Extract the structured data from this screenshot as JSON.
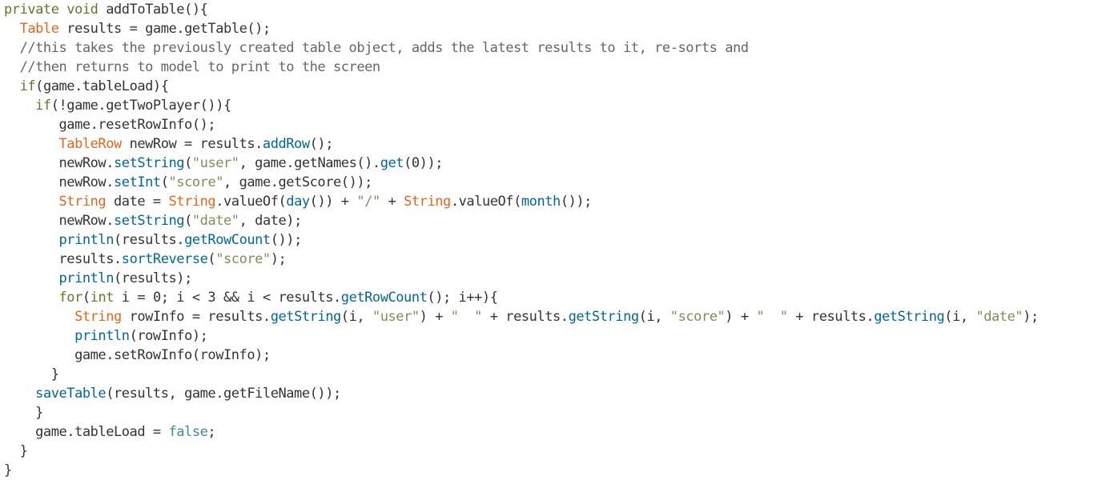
{
  "code": {
    "lines": [
      {
        "tokens": [
          {
            "t": "private void",
            "k": "kw"
          },
          {
            "t": " addToTable(){",
            "k": "plain"
          }
        ]
      },
      {
        "tokens": [
          {
            "t": "  ",
            "k": "plain"
          },
          {
            "t": "Table",
            "k": "type"
          },
          {
            "t": " results = game.getTable();",
            "k": "plain"
          }
        ]
      },
      {
        "tokens": [
          {
            "t": "  //this takes the previously created table object, adds the latest results to it, re-sorts and",
            "k": "comment"
          }
        ]
      },
      {
        "tokens": [
          {
            "t": "  //then returns to model to print to the screen",
            "k": "comment"
          }
        ]
      },
      {
        "tokens": [
          {
            "t": "  ",
            "k": "plain"
          },
          {
            "t": "if",
            "k": "kw"
          },
          {
            "t": "(game.tableLoad){",
            "k": "plain"
          }
        ]
      },
      {
        "tokens": [
          {
            "t": "    ",
            "k": "plain"
          },
          {
            "t": "if",
            "k": "kw"
          },
          {
            "t": "(!game.getTwoPlayer()){",
            "k": "plain"
          }
        ]
      },
      {
        "tokens": [
          {
            "t": "       game.resetRowInfo();",
            "k": "plain"
          }
        ]
      },
      {
        "tokens": [
          {
            "t": "       ",
            "k": "plain"
          },
          {
            "t": "TableRow",
            "k": "type"
          },
          {
            "t": " newRow = results.",
            "k": "plain"
          },
          {
            "t": "addRow",
            "k": "fn"
          },
          {
            "t": "();",
            "k": "plain"
          }
        ]
      },
      {
        "tokens": [
          {
            "t": "       newRow.",
            "k": "plain"
          },
          {
            "t": "setString",
            "k": "fn"
          },
          {
            "t": "(",
            "k": "plain"
          },
          {
            "t": "\"user\"",
            "k": "str"
          },
          {
            "t": ", game.getNames().",
            "k": "plain"
          },
          {
            "t": "get",
            "k": "fn"
          },
          {
            "t": "(0));",
            "k": "plain"
          }
        ]
      },
      {
        "tokens": [
          {
            "t": "       newRow.",
            "k": "plain"
          },
          {
            "t": "setInt",
            "k": "fn"
          },
          {
            "t": "(",
            "k": "plain"
          },
          {
            "t": "\"score\"",
            "k": "str"
          },
          {
            "t": ", game.getScore());",
            "k": "plain"
          }
        ]
      },
      {
        "tokens": [
          {
            "t": "       ",
            "k": "plain"
          },
          {
            "t": "String",
            "k": "type"
          },
          {
            "t": " date = ",
            "k": "plain"
          },
          {
            "t": "String",
            "k": "type"
          },
          {
            "t": ".valueOf(",
            "k": "plain"
          },
          {
            "t": "day",
            "k": "fn"
          },
          {
            "t": "()) + ",
            "k": "plain"
          },
          {
            "t": "\"/\"",
            "k": "str"
          },
          {
            "t": " + ",
            "k": "plain"
          },
          {
            "t": "String",
            "k": "type"
          },
          {
            "t": ".valueOf(",
            "k": "plain"
          },
          {
            "t": "month",
            "k": "fn"
          },
          {
            "t": "());",
            "k": "plain"
          }
        ]
      },
      {
        "tokens": [
          {
            "t": "       newRow.",
            "k": "plain"
          },
          {
            "t": "setString",
            "k": "fn"
          },
          {
            "t": "(",
            "k": "plain"
          },
          {
            "t": "\"date\"",
            "k": "str"
          },
          {
            "t": ", date);",
            "k": "plain"
          }
        ]
      },
      {
        "tokens": [
          {
            "t": "       ",
            "k": "plain"
          },
          {
            "t": "println",
            "k": "fn"
          },
          {
            "t": "(results.",
            "k": "plain"
          },
          {
            "t": "getRowCount",
            "k": "fn"
          },
          {
            "t": "());",
            "k": "plain"
          }
        ]
      },
      {
        "tokens": [
          {
            "t": "       results.",
            "k": "plain"
          },
          {
            "t": "sortReverse",
            "k": "fn"
          },
          {
            "t": "(",
            "k": "plain"
          },
          {
            "t": "\"score\"",
            "k": "str"
          },
          {
            "t": ");",
            "k": "plain"
          }
        ]
      },
      {
        "tokens": [
          {
            "t": "       ",
            "k": "plain"
          },
          {
            "t": "println",
            "k": "fn"
          },
          {
            "t": "(results);",
            "k": "plain"
          }
        ]
      },
      {
        "tokens": [
          {
            "t": "       ",
            "k": "plain"
          },
          {
            "t": "for",
            "k": "kw"
          },
          {
            "t": "(",
            "k": "plain"
          },
          {
            "t": "int",
            "k": "kw"
          },
          {
            "t": " i = 0; i < 3 && i < results.",
            "k": "plain"
          },
          {
            "t": "getRowCount",
            "k": "fn"
          },
          {
            "t": "(); i++){",
            "k": "plain"
          }
        ]
      },
      {
        "tokens": [
          {
            "t": "         ",
            "k": "plain"
          },
          {
            "t": "String",
            "k": "type"
          },
          {
            "t": " rowInfo = results.",
            "k": "plain"
          },
          {
            "t": "getString",
            "k": "fn"
          },
          {
            "t": "(i, ",
            "k": "plain"
          },
          {
            "t": "\"user\"",
            "k": "str"
          },
          {
            "t": ") + ",
            "k": "plain"
          },
          {
            "t": "\"  \"",
            "k": "str"
          },
          {
            "t": " + results.",
            "k": "plain"
          },
          {
            "t": "getString",
            "k": "fn"
          },
          {
            "t": "(i, ",
            "k": "plain"
          },
          {
            "t": "\"score\"",
            "k": "str"
          },
          {
            "t": ") + ",
            "k": "plain"
          },
          {
            "t": "\"  \"",
            "k": "str"
          },
          {
            "t": " + results.",
            "k": "plain"
          },
          {
            "t": "getString",
            "k": "fn"
          },
          {
            "t": "(i, ",
            "k": "plain"
          },
          {
            "t": "\"date\"",
            "k": "str"
          },
          {
            "t": ");",
            "k": "plain"
          }
        ]
      },
      {
        "tokens": [
          {
            "t": "         ",
            "k": "plain"
          },
          {
            "t": "println",
            "k": "fn"
          },
          {
            "t": "(rowInfo);",
            "k": "plain"
          }
        ]
      },
      {
        "tokens": [
          {
            "t": "         game.setRowInfo(rowInfo);",
            "k": "plain"
          }
        ]
      },
      {
        "tokens": [
          {
            "t": "      }",
            "k": "plain"
          }
        ]
      },
      {
        "tokens": [
          {
            "t": "    ",
            "k": "plain"
          },
          {
            "t": "saveTable",
            "k": "fn"
          },
          {
            "t": "(results, game.getFileName());",
            "k": "plain"
          }
        ]
      },
      {
        "tokens": [
          {
            "t": "    }",
            "k": "plain"
          }
        ]
      },
      {
        "tokens": [
          {
            "t": "    game.tableLoad = ",
            "k": "plain"
          },
          {
            "t": "false",
            "k": "const"
          },
          {
            "t": ";",
            "k": "plain"
          }
        ]
      },
      {
        "tokens": [
          {
            "t": "  }",
            "k": "plain"
          }
        ]
      },
      {
        "tokens": [
          {
            "t": "}",
            "k": "plain"
          }
        ]
      }
    ],
    "colors": {
      "background": "#ffffff",
      "plain": "#333333",
      "keyword": "#5f7a22",
      "type": "#e2661a",
      "function": "#006699",
      "string": "#7d8e5a",
      "comment": "#666666",
      "constant": "#3a8e8a"
    }
  }
}
